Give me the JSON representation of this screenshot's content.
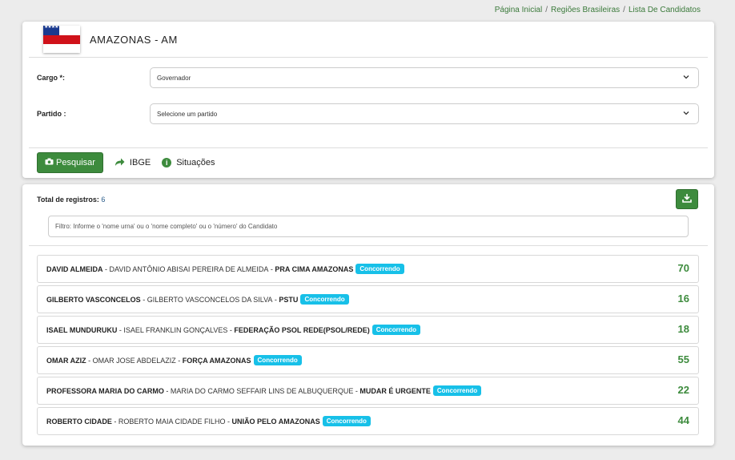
{
  "breadcrumb": [
    "Página Inicial",
    "Regiões Brasileiras",
    "Lista De Candidatos"
  ],
  "state": {
    "title": "AMAZONAS - AM"
  },
  "form": {
    "cargo_label": "Cargo *:",
    "cargo_value": "Governador",
    "partido_label": "Partido :",
    "partido_value": "Selecione um partido"
  },
  "toolbar": {
    "pesquisar": "Pesquisar",
    "ibge": "IBGE",
    "situacoes": "Situações"
  },
  "results": {
    "total_label": "Total de registros:",
    "total_count": "6",
    "filter_placeholder": "Filtro: Informe o 'nome urna' ou o 'nome completo' ou o 'número' do Candidato"
  },
  "candidates": [
    {
      "name": "DAVID ALMEIDA",
      "full": "DAVID ANTÔNIO ABISAI PEREIRA DE ALMEIDA",
      "party": "PRA CIMA AMAZONAS",
      "status": "Concorrendo",
      "number": "70"
    },
    {
      "name": "GILBERTO VASCONCELOS",
      "full": "GILBERTO VASCONCELOS DA SILVA",
      "party": "PSTU",
      "status": "Concorrendo",
      "number": "16"
    },
    {
      "name": "ISAEL MUNDURUKU",
      "full": "ISAEL FRANKLIN GONÇALVES",
      "party": "FEDERAÇÃO PSOL REDE(PSOL/REDE)",
      "status": "Concorrendo",
      "number": "18"
    },
    {
      "name": "OMAR AZIZ",
      "full": "OMAR JOSE ABDELAZIZ",
      "party": "FORÇA AMAZONAS",
      "status": "Concorrendo",
      "number": "55"
    },
    {
      "name": "PROFESSORA MARIA DO CARMO",
      "full": "MARIA DO CARMO SEFFAIR LINS DE ALBUQUERQUE",
      "party": "MUDAR É URGENTE",
      "status": "Concorrendo",
      "number": "22"
    },
    {
      "name": "ROBERTO CIDADE",
      "full": "ROBERTO MAIA CIDADE FILHO",
      "party": "UNIÃO PELO AMAZONAS",
      "status": "Concorrendo",
      "number": "44"
    }
  ],
  "colors": {
    "accent": "#3d8b3d",
    "badge": "#17c0e8"
  },
  "icons": [
    "camera-icon",
    "share-arrow-icon",
    "info-icon",
    "download-icon",
    "chevron-down-icon"
  ]
}
